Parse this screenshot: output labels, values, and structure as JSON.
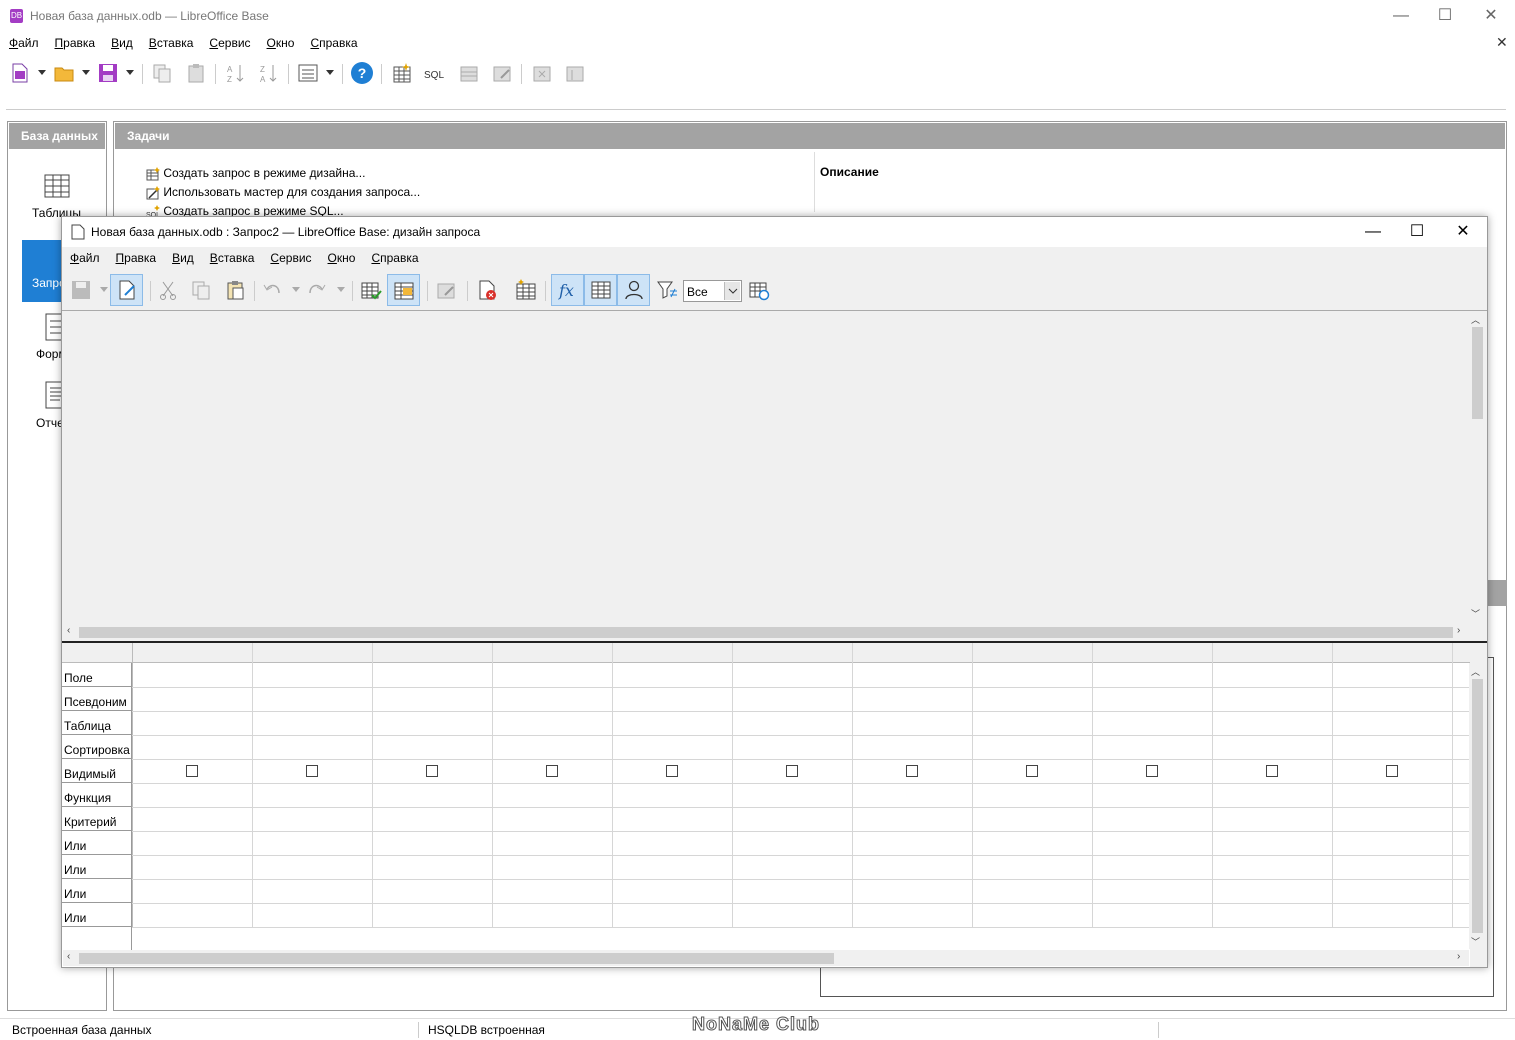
{
  "main_window": {
    "title": "Новая база данных.odb — LibreOffice Base",
    "app_icon_text": "DB",
    "controls": {
      "minimize": "—",
      "maximize": "☐",
      "close": "✕"
    },
    "menu": [
      {
        "label": "Файл",
        "key": "Ф",
        "rest": "айл"
      },
      {
        "label": "Правка",
        "key": "П",
        "rest": "равка"
      },
      {
        "label": "Вид",
        "key": "В",
        "rest": "ид"
      },
      {
        "label": "Вставка",
        "key": "В",
        "rest": "ставка"
      },
      {
        "label": "Сервис",
        "key": "С",
        "rest": "ервис"
      },
      {
        "label": "Окно",
        "key": "О",
        "rest": "кно"
      },
      {
        "label": "Справка",
        "key": "С",
        "rest": "правка"
      }
    ],
    "menu_close": "✕",
    "toolbar": {
      "sql_label": "SQL",
      "help_label": "?"
    }
  },
  "left_panel": {
    "title": "База данных",
    "items": [
      {
        "label": "Таблицы",
        "icon": "table-icon"
      },
      {
        "label": "Запросы",
        "icon": "query-icon",
        "visible": "Запро"
      },
      {
        "label": "Формы",
        "icon": "form-icon",
        "visible": "Форм"
      },
      {
        "label": "Отчёты",
        "icon": "report-icon",
        "visible": "Отче"
      }
    ]
  },
  "tasks_panel": {
    "title": "Задачи",
    "tasks": [
      "Создать запрос в режиме дизайна...",
      "Использовать мастер для создания запроса...",
      "Создать запрос в режиме SQL..."
    ],
    "description_title": "Описание"
  },
  "query_window": {
    "title": "Новая база данных.odb : Запрос2 — LibreOffice Base: дизайн запроса",
    "controls": {
      "minimize": "—",
      "maximize": "☐",
      "close": "✕"
    },
    "menu": [
      {
        "key": "Ф",
        "rest": "айл"
      },
      {
        "key": "П",
        "rest": "равка"
      },
      {
        "key": "В",
        "rest": "ид"
      },
      {
        "key": "В",
        "rest": "ставка"
      },
      {
        "key": "С",
        "rest": "ервис"
      },
      {
        "key": "О",
        "rest": "кно"
      },
      {
        "key": "С",
        "rest": "правка"
      }
    ],
    "limit_select": "Все",
    "row_labels": [
      "Поле",
      "Псевдоним",
      "Таблица",
      "Сортировка",
      "Видимый",
      "Функция",
      "Критерий",
      "Или",
      "Или",
      "Или",
      "Или"
    ],
    "visible_checked": [
      false,
      false,
      false,
      false,
      false,
      false,
      false,
      false,
      false,
      false,
      false
    ]
  },
  "status_bar": {
    "left": "Встроенная база данных",
    "middle": "HSQLDB встроенная",
    "watermark": "NoNaMe Club"
  }
}
